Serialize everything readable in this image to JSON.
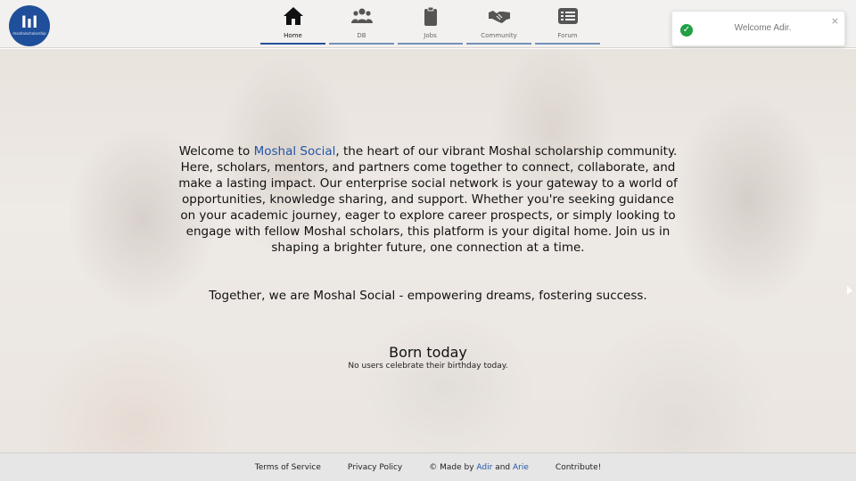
{
  "logo": {
    "mark": "lıl",
    "brand": "moshalscholarship"
  },
  "nav": {
    "items": [
      {
        "label": "Home",
        "icon": "home-icon"
      },
      {
        "label": "DB",
        "icon": "users-icon"
      },
      {
        "label": "Jobs",
        "icon": "clipboard-icon"
      },
      {
        "label": "Community",
        "icon": "handshake-icon"
      },
      {
        "label": "Forum",
        "icon": "list-icon"
      }
    ],
    "active": "Home"
  },
  "toast": {
    "message": "Welcome Adir.",
    "close": "×"
  },
  "hero": {
    "welcome_prefix": "Welcome to ",
    "welcome_brand": "Moshal Social",
    "welcome_body": ", the heart of our vibrant Moshal scholarship community. Here, scholars, mentors, and partners come together to connect, collaborate, and make a lasting impact. Our enterprise social network is your gateway to a world of opportunities, knowledge sharing, and support. Whether you're seeking guidance on your academic journey, eager to explore career prospects, or simply looking to engage with fellow Moshal scholars, this platform is your digital home. Join us in shaping a brighter future, one connection at a time.",
    "tagline": "Together, we are Moshal Social - empowering dreams, fostering success.",
    "born_title": "Born today",
    "born_text": "No users celebrate their birthday today."
  },
  "footer": {
    "terms": "Terms of Service",
    "privacy": "Privacy Policy",
    "made_prefix": "© Made by ",
    "author1": "Adir",
    "and": " and ",
    "author2": "Arie",
    "contribute": "Contribute!"
  },
  "colors": {
    "accent": "#2456a6",
    "success": "#22a046",
    "logo_bg": "#1f4f9a"
  }
}
